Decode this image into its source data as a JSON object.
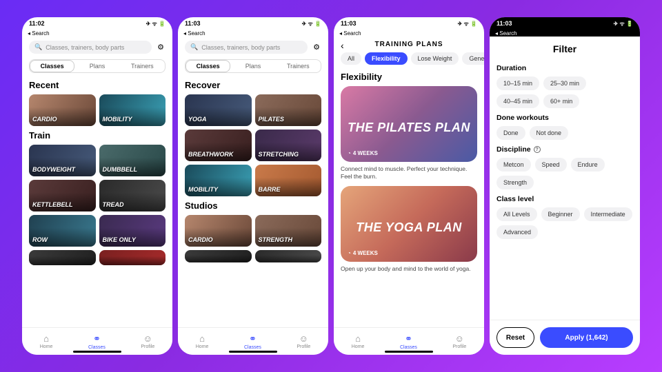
{
  "status": {
    "time_a": "11:02",
    "time_b": "11:03",
    "icons": "✈ ᯤ 🔋"
  },
  "back_label": "◂ Search",
  "search": {
    "placeholder": "Classes, trainers, body parts"
  },
  "segments": [
    "Classes",
    "Plans",
    "Trainers"
  ],
  "s1": {
    "sec1": "Recent",
    "sec1_cards": [
      "CARDIO",
      "MOBILITY"
    ],
    "sec2": "Train",
    "sec2_cards": [
      "BODYWEIGHT",
      "DUMBBELL",
      "KETTLEBELL",
      "TREAD",
      "ROW",
      "BIKE ONLY"
    ]
  },
  "s2": {
    "sec1": "Recover",
    "sec1_cards": [
      "YOGA",
      "PILATES",
      "BREATHWORK",
      "STRETCHING",
      "MOBILITY",
      "BARRE"
    ],
    "sec2": "Studios",
    "sec2_cards": [
      "CARDIO",
      "STRENGTH"
    ]
  },
  "s3": {
    "title": "TRAINING PLANS",
    "tabs": [
      "All",
      "Flexibility",
      "Lose Weight",
      "General"
    ],
    "active_tab": 1,
    "section": "Flexibility",
    "plans": [
      {
        "title": "THE PILATES PLAN",
        "duration": "4 WEEKS",
        "desc": "Connect mind to muscle. Perfect your technique. Feel the burn."
      },
      {
        "title": "THE YOGA PLAN",
        "duration": "4 WEEKS",
        "desc": "Open up your body and mind to the world of yoga."
      }
    ]
  },
  "s4": {
    "title": "Filter",
    "groups": [
      {
        "label": "Duration",
        "opts": [
          "10–15 min",
          "25–30 min",
          "40–45 min",
          "60+ min"
        ]
      },
      {
        "label": "Done workouts",
        "opts": [
          "Done",
          "Not done"
        ]
      },
      {
        "label": "Discipline",
        "info": true,
        "opts": [
          "Metcon",
          "Speed",
          "Endure",
          "Strength"
        ]
      },
      {
        "label": "Class level",
        "opts": [
          "All Levels",
          "Beginner",
          "Intermediate",
          "Advanced"
        ]
      }
    ],
    "reset": "Reset",
    "apply": "Apply (1,642)"
  },
  "tabs": {
    "home": "Home",
    "classes": "Classes",
    "profile": "Profile"
  }
}
